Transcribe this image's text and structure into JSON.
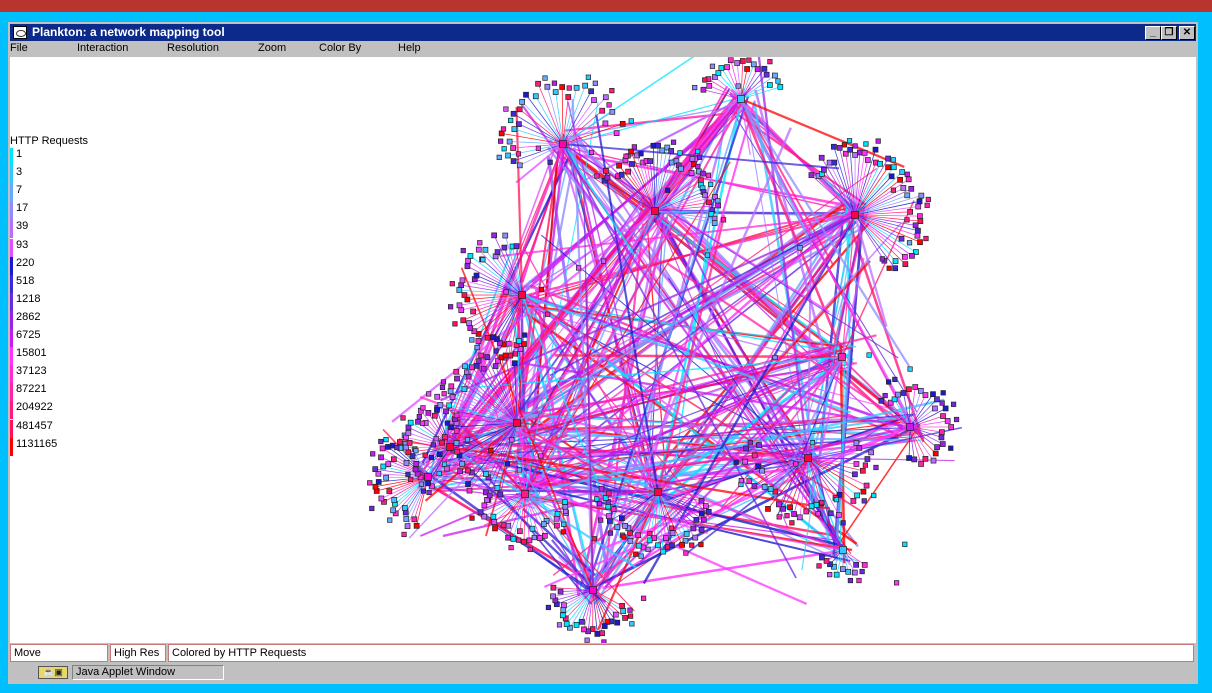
{
  "window": {
    "title": "Plankton: a network mapping tool",
    "buttons": [
      "_",
      "❐",
      "✕"
    ]
  },
  "menu": [
    "File",
    "Interaction",
    "Resolution",
    "Zoom",
    "Color By",
    "Help"
  ],
  "legend": {
    "title": "HTTP Requests",
    "items": [
      {
        "label": "1",
        "color": "#00e5ff"
      },
      {
        "label": "3",
        "color": "#33c8ff"
      },
      {
        "label": "7",
        "color": "#66aaff"
      },
      {
        "label": "17",
        "color": "#8f8cff"
      },
      {
        "label": "39",
        "color": "#b96dff"
      },
      {
        "label": "93",
        "color": "#e050ff"
      },
      {
        "label": "220",
        "color": "#1a1acc"
      },
      {
        "label": "518",
        "color": "#3a2ad8"
      },
      {
        "label": "1218",
        "color": "#6a2adf"
      },
      {
        "label": "2862",
        "color": "#9a22e6"
      },
      {
        "label": "6725",
        "color": "#c81aef"
      },
      {
        "label": "15801",
        "color": "#ff33ff"
      },
      {
        "label": "37123",
        "color": "#ff2ad5"
      },
      {
        "label": "87221",
        "color": "#ff22aa"
      },
      {
        "label": "204922",
        "color": "#ff1a80"
      },
      {
        "label": "481457",
        "color": "#ff1155"
      },
      {
        "label": "1131165",
        "color": "#ff0000"
      }
    ]
  },
  "status": {
    "mode": "Move",
    "resolution": "High Res",
    "message": "Colored by HTTP Requests"
  },
  "applet": {
    "label": "Java Applet Window"
  },
  "colors": {
    "background": "#b8352f",
    "frame": "#00bfff",
    "titlebar": "#0b2a8a"
  }
}
